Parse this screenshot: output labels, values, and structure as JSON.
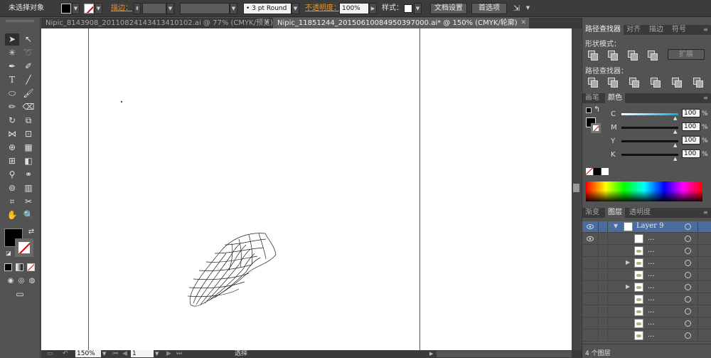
{
  "control_bar": {
    "selection_status": "未选择对象",
    "stroke_label": "描边：",
    "brush_profile": "• 3 pt Round",
    "opacity_label": "不透明度：",
    "opacity_value": "100%",
    "style_label": "样式：",
    "doc_setup_button": "文档设置",
    "preferences_button": "首选项"
  },
  "document_tabs": [
    {
      "label": "Nipic_8143908_20110824143413410102.ai @ 77% (CMYK/预览)",
      "close": "✕"
    },
    {
      "label": "Nipic_11851244_20150610084950397000.ai* @ 150% (CMYK/轮廓)",
      "close": "✕"
    }
  ],
  "status_bar": {
    "zoom": "150%",
    "artboard": "1",
    "mode_label": "选择"
  },
  "pathfinder_panel": {
    "tabs": [
      "路径查找器",
      "对齐",
      "描边",
      "符号"
    ],
    "shape_modes_label": "形状模式：",
    "expand_button": "扩展",
    "pathfinders_label": "路径查找器："
  },
  "color_panel": {
    "tabs": [
      "画笔",
      "颜色"
    ],
    "channels": [
      {
        "name": "C",
        "value": "100",
        "unit": "%"
      },
      {
        "name": "M",
        "value": "100",
        "unit": "%"
      },
      {
        "name": "Y",
        "value": "100",
        "unit": "%"
      },
      {
        "name": "K",
        "value": "100",
        "unit": "%"
      }
    ]
  },
  "layers_panel": {
    "tabs": [
      "渐变",
      "图层",
      "透明度"
    ],
    "layer_name": "Layer 9",
    "sublayer_label": "...",
    "layer_count": "4 个图层"
  },
  "colors": {
    "panel_bg": "#535353",
    "bar_bg": "#3c3c3c",
    "accent_orange": "#e8922a",
    "selection_blue": "#4b6d9e"
  }
}
